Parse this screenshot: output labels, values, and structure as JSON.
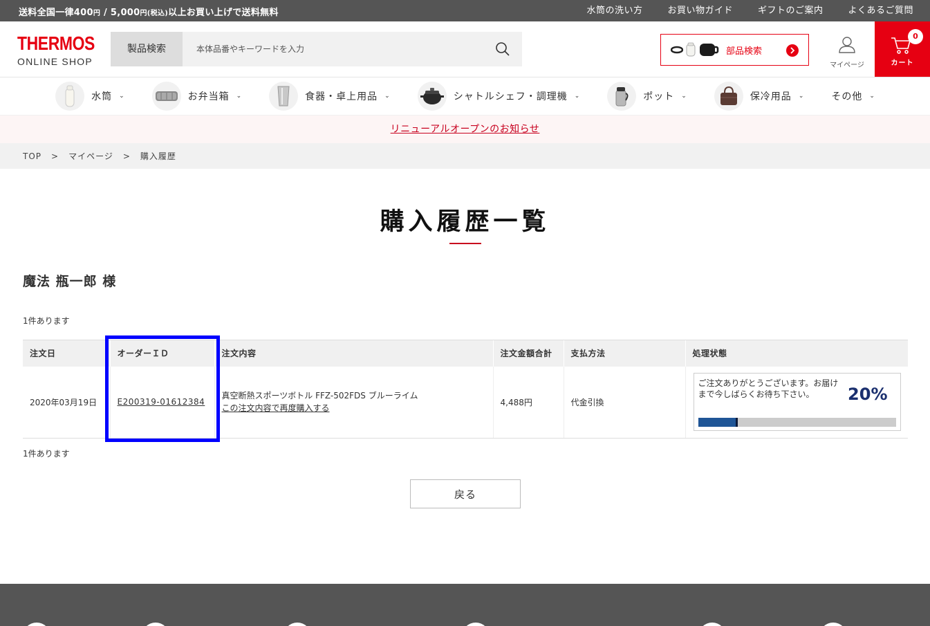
{
  "topbar": {
    "notice_main": "送料全国一律400",
    "notice_yen1": "円",
    "notice_mid": " / 5,000",
    "notice_yen2": "円",
    "notice_tax": "(税込)",
    "notice_end": "以上お買い上げで送料無料",
    "links": [
      "水筒の洗い方",
      "お買い物ガイド",
      "ギフトのご案内",
      "よくあるご質問"
    ]
  },
  "header": {
    "logo_brand": "THERMOS",
    "logo_sub": "ONLINE SHOP",
    "search_label": "製品検索",
    "search_placeholder": "本体品番やキーワードを入力",
    "parts_label": "部品検索",
    "mypage_label": "マイページ",
    "cart_label": "カート",
    "cart_count": "0"
  },
  "categories": [
    {
      "label": "水筒",
      "icon": "bottle-icon"
    },
    {
      "label": "お弁当箱",
      "icon": "lunchbox-icon"
    },
    {
      "label": "食器・卓上用品",
      "icon": "tumbler-icon"
    },
    {
      "label": "シャトルシェフ・調理機",
      "icon": "pot-icon"
    },
    {
      "label": "ポット",
      "icon": "carafe-icon"
    },
    {
      "label": "保冷用品",
      "icon": "bag-icon"
    },
    {
      "label": "その他",
      "icon": ""
    }
  ],
  "renewal_notice": "リニューアルオープンのお知らせ",
  "breadcrumb": {
    "items": [
      "TOP",
      "マイページ",
      "購入履歴"
    ],
    "separator": ">"
  },
  "page_title": "購入履歴一覧",
  "customer_name": "魔法 瓶一郎 様",
  "count_text": "1件あります",
  "table": {
    "headers": [
      "注文日",
      "オーダーＩＤ",
      "注文内容",
      "注文金額合計",
      "支払方法",
      "処理状態"
    ],
    "rows": [
      {
        "date": "2020年03月19日",
        "order_id": "E200319-01612384",
        "product": "真空断熱スポーツボトル FFZ-502FDS ブルーライム",
        "reorder_link": "この注文内容で再度購入する",
        "total": "4,488円",
        "payment": "代金引換",
        "status_message": "ご注文ありがとうございます。お届けまで今しばらくお待ち下さい。",
        "progress_percent_label": "20%",
        "progress": 0.2
      }
    ]
  },
  "back_label": "戻る"
}
